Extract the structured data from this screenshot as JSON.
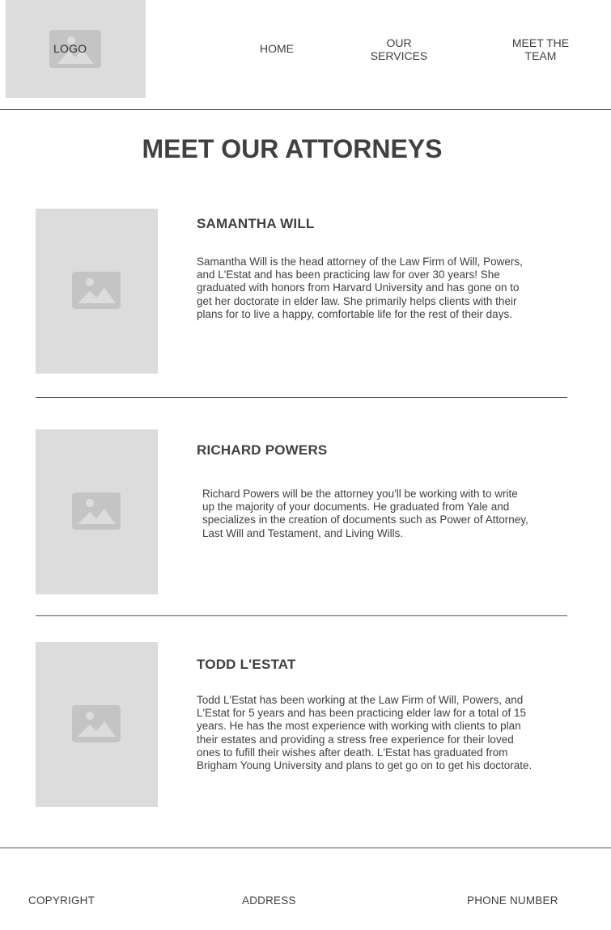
{
  "header": {
    "logo_label": "LOGO",
    "nav": {
      "home": "HOME",
      "services_line1": "OUR",
      "services_line2": "SERVICES",
      "team_line1": "MEET THE",
      "team_line2": "TEAM"
    }
  },
  "main": {
    "title": "MEET OUR ATTORNEYS",
    "attorneys": [
      {
        "name": "SAMANTHA WILL",
        "bio": "Samantha Will is the head attorney of the Law Firm of Will, Powers, and L'Estat and has been practicing law for over 30 years! She graduated with honors from Harvard University and has gone on to get her doctorate in elder law. She primarily helps clients with their plans for to live a happy, comfortable life for the rest of their days."
      },
      {
        "name": "RICHARD POWERS",
        "bio": "Richard Powers will be the attorney you'll be working with to write up the majority of your documents. He graduated from Yale and specializes in the creation of documents such as Power of Attorney, Last Will and Testament, and Living Wills."
      },
      {
        "name": "TODD L'ESTAT",
        "bio": "Todd L'Estat has been working at the Law Firm of Will, Powers, and L'Estat for 5 years and has been practicing elder law for a total of 15 years. He has the most experience with working with clients to plan their estates and providing a stress free experience for their loved ones to fufill their wishes after death. L'Estat has graduated from Brigham Young University and plans to get go on to get his doctorate."
      }
    ]
  },
  "footer": {
    "copyright": "COPYRIGHT",
    "address": "ADDRESS",
    "phone": "PHONE NUMBER"
  },
  "icons": {
    "placeholder": "image-placeholder-icon"
  },
  "colors": {
    "placeholder_bg": "#dcdcdc",
    "placeholder_icon": "#c4c4c4",
    "text": "#404040",
    "rule": "#555555"
  }
}
